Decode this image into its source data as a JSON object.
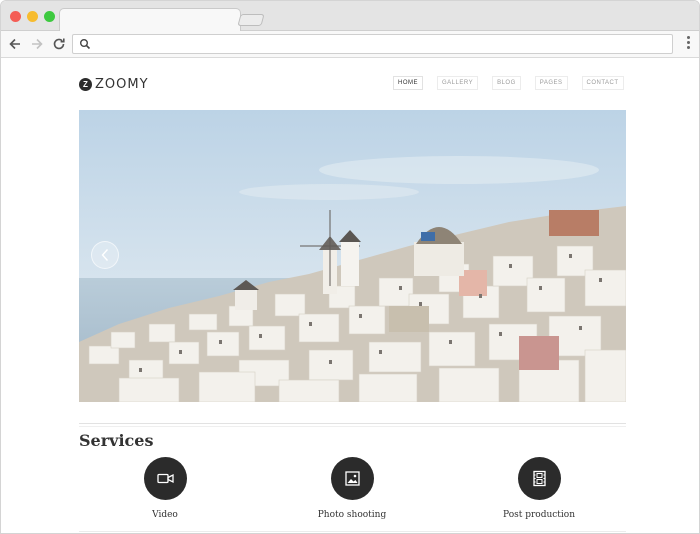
{
  "browser": {
    "url": "",
    "icons": {
      "back": "back-arrow-icon",
      "forward": "forward-arrow-icon",
      "reload": "reload-icon",
      "search": "search-icon",
      "menu": "kebab-menu-icon"
    }
  },
  "site": {
    "logo_mark": "Z",
    "logo_text": "ZOOMY",
    "nav": [
      {
        "label": "HOME",
        "active": true
      },
      {
        "label": "GALLERY",
        "active": false
      },
      {
        "label": "BLOG",
        "active": false
      },
      {
        "label": "PAGES",
        "active": false
      },
      {
        "label": "CONTACT",
        "active": false
      }
    ]
  },
  "hero": {
    "prev_icon": "chevron-left-icon"
  },
  "services": {
    "title": "Services",
    "items": [
      {
        "label": "Video",
        "icon": "video-camera-icon"
      },
      {
        "label": "Photo shooting",
        "icon": "photo-icon"
      },
      {
        "label": "Post production",
        "icon": "film-icon"
      }
    ]
  },
  "colors": {
    "dark": "#2b2b2b",
    "sky": "#c9dcea",
    "sea": "#9fb9cc"
  }
}
